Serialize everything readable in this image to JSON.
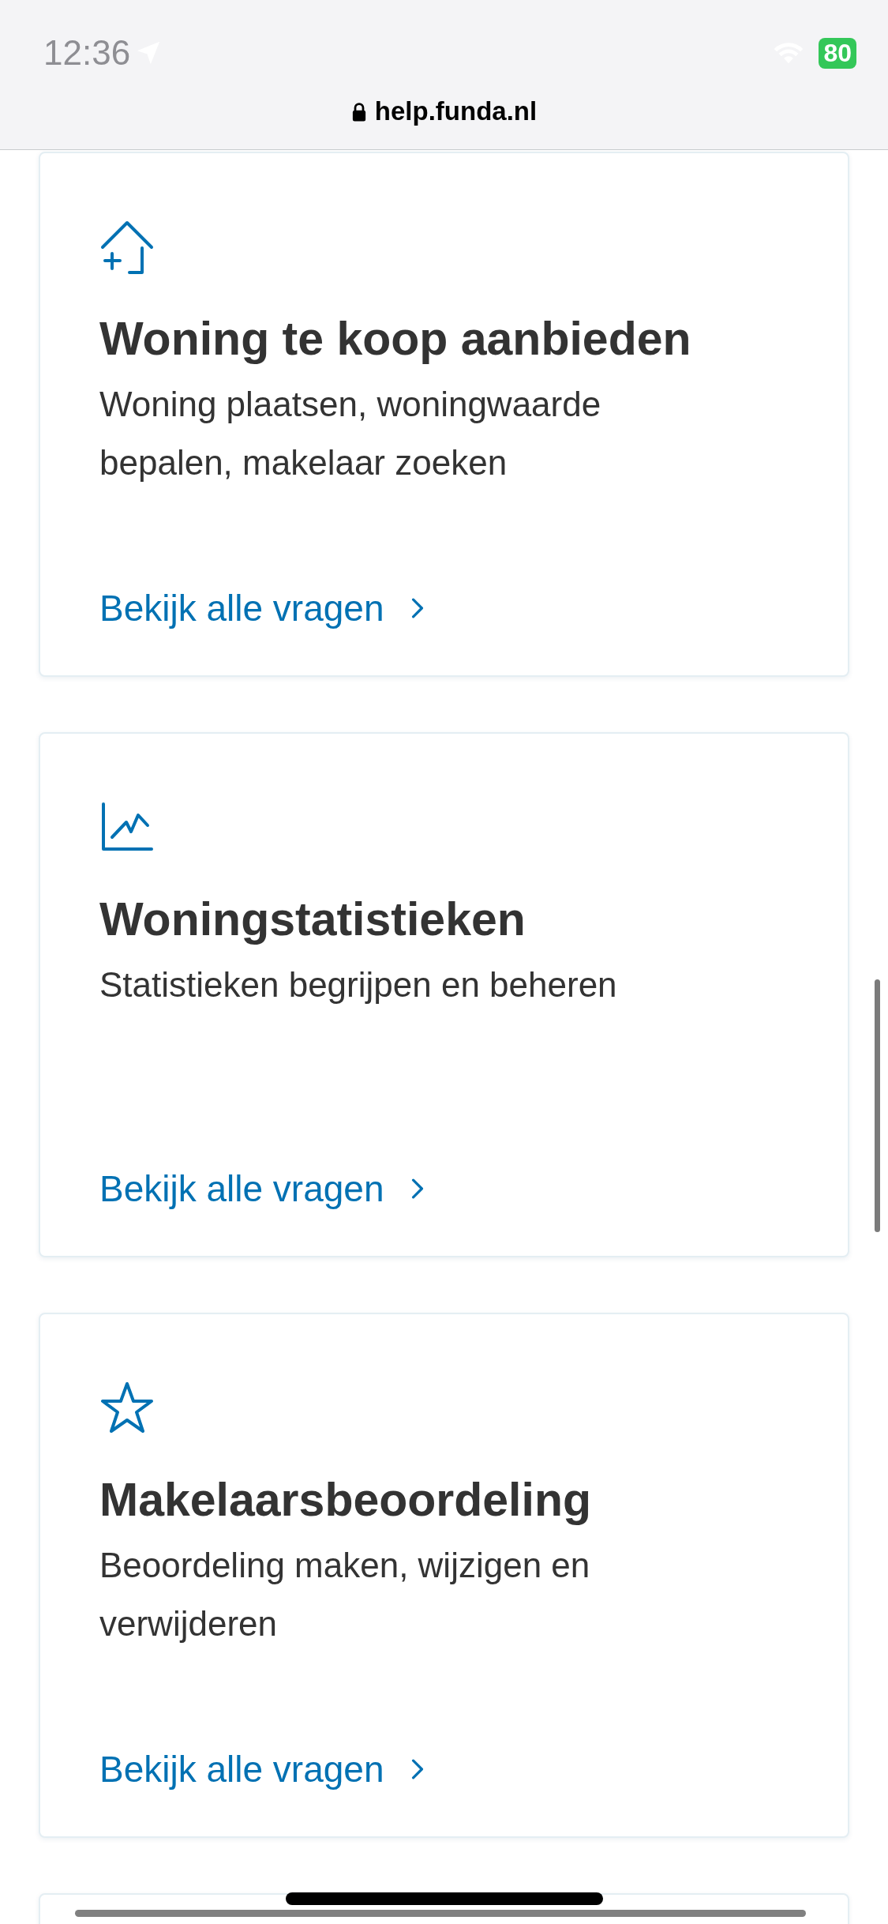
{
  "status_bar": {
    "time": "12:36",
    "battery": "80"
  },
  "address_bar": {
    "url": "help.funda.nl"
  },
  "cards": [
    {
      "kind": "house-plus",
      "title": "Woning te koop aanbieden",
      "description": "Woning plaatsen, woningwaarde bepalen, makelaar zoeken",
      "link": "Bekijk alle vragen"
    },
    {
      "kind": "chart",
      "title": "Woningstatistieken",
      "description": "Statistieken begrijpen en beheren",
      "link": "Bekijk alle vragen"
    },
    {
      "kind": "star",
      "title": "Makelaarsbeoordeling",
      "description": "Beoordeling maken, wijzigen en verwijderen",
      "link": "Bekijk alle vragen"
    }
  ]
}
